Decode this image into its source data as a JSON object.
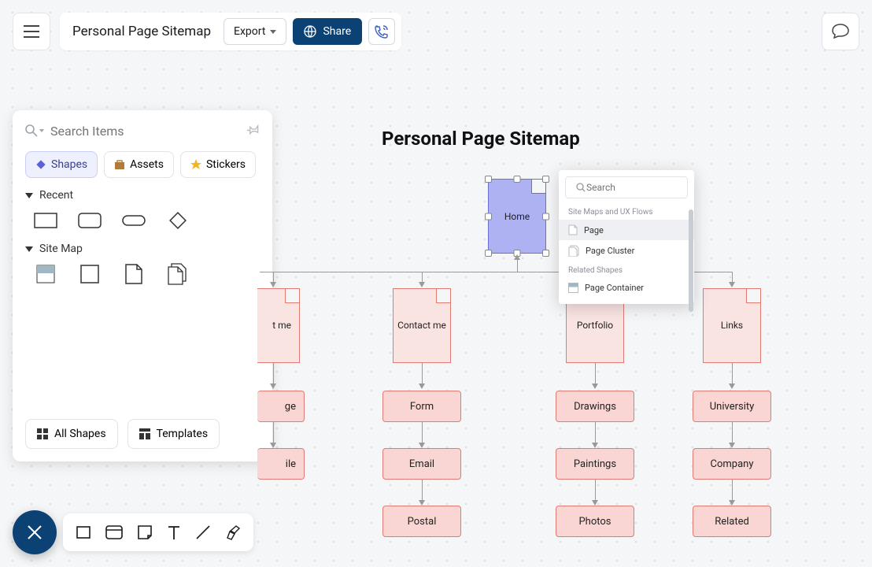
{
  "header": {
    "doc_title": "Personal Page Sitemap",
    "export_label": "Export",
    "share_label": "Share"
  },
  "panel": {
    "search_placeholder": "Search Items",
    "tabs": {
      "shapes": "Shapes",
      "assets": "Assets",
      "stickers": "Stickers"
    },
    "section_recent": "Recent",
    "section_sitemap": "Site Map",
    "all_shapes": "All Shapes",
    "templates": "Templates"
  },
  "canvas": {
    "title": "Personal Page Sitemap",
    "home": "Home",
    "columns": [
      {
        "page": "t me",
        "page_cut": true,
        "boxes": [
          "ge",
          "ile"
        ],
        "boxes_cut": true
      },
      {
        "page": "Contact me",
        "boxes": [
          "Form",
          "Email",
          "Postal"
        ]
      },
      {
        "page": "Portfolio",
        "boxes": [
          "Drawings",
          "Paintings",
          "Photos"
        ]
      },
      {
        "page": "Links",
        "boxes": [
          "University",
          "Company",
          "Related"
        ]
      }
    ]
  },
  "popup": {
    "search_placeholder": "Search",
    "group1": "Site Maps and UX Flows",
    "items1": [
      "Page",
      "Page Cluster"
    ],
    "group2": "Related Shapes",
    "items2": [
      "Page Container"
    ]
  }
}
